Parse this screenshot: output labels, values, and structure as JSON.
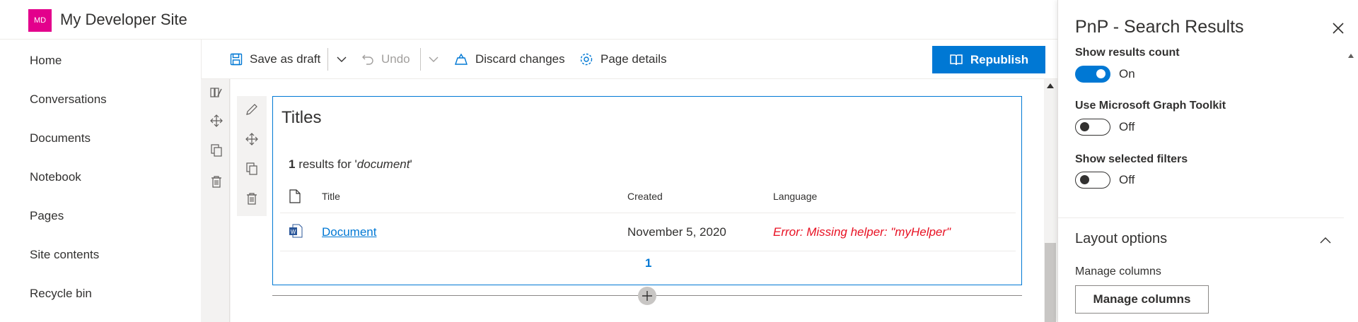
{
  "site": {
    "logo_text": "MD",
    "title": "My Developer Site",
    "logo_color": "#e3008c"
  },
  "nav": {
    "items": [
      "Home",
      "Conversations",
      "Documents",
      "Notebook",
      "Pages",
      "Site contents",
      "Recycle bin"
    ]
  },
  "toolbar": {
    "save_draft": "Save as draft",
    "undo": "Undo",
    "discard": "Discard changes",
    "page_details": "Page details",
    "republish": "Republish"
  },
  "webpart": {
    "title": "Titles",
    "results_count": "1",
    "results_text": " results for '",
    "results_query": "document",
    "results_end": "'",
    "columns": [
      "Title",
      "Created",
      "Language"
    ],
    "rows": [
      {
        "title": "Document",
        "created": "November 5, 2020",
        "language": "Error: Missing helper: \"myHelper\""
      }
    ],
    "page": "1"
  },
  "pane": {
    "title": "PnP - Search Results",
    "show_results_count": {
      "label": "Show results count",
      "state": "On"
    },
    "use_graph_toolkit": {
      "label": "Use Microsoft Graph Toolkit",
      "state": "Off"
    },
    "show_selected_filters": {
      "label": "Show selected filters",
      "state": "Off"
    },
    "layout_options": "Layout options",
    "manage_columns_label": "Manage columns",
    "manage_columns_button": "Manage columns"
  },
  "colors": {
    "accent": "#0078d4",
    "error": "#e81123"
  }
}
